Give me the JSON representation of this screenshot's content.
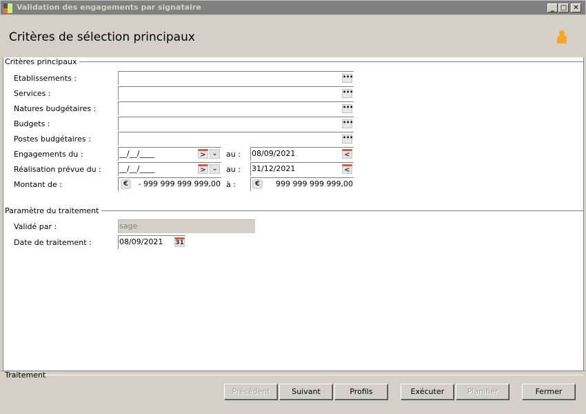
{
  "window": {
    "title": "Validation des engagements par signataire"
  },
  "header": {
    "title": "Critères de sélection principaux",
    "user_icon": "user-icon"
  },
  "main": {
    "section_title": "Critères principaux",
    "fields": [
      {
        "label": "Etablissements :",
        "value": ""
      },
      {
        "label": "Services :",
        "value": ""
      },
      {
        "label": "Natures budgétaires :",
        "value": ""
      },
      {
        "label": "Budgets :",
        "value": ""
      },
      {
        "label": "Postes budgétaires :",
        "value": ""
      }
    ],
    "engagements": {
      "label": "Engagements du :",
      "from": "__/__/____",
      "to_label": "au :",
      "to": "08/09/2021"
    },
    "realisation": {
      "label": "Réalisation prévue du :",
      "from": "__/__/____",
      "to_label": "au :",
      "to": "31/12/2021"
    },
    "montant": {
      "label": "Montant de :",
      "from": "- 999 999 999 999,00",
      "to_label": "à :",
      "to": "999 999 999 999,00"
    }
  },
  "params": {
    "section_title": "Paramètre du traitement",
    "valide_par": {
      "label": "Validé par :",
      "value": "sage"
    },
    "date_traitement": {
      "label": "Date de traitement :",
      "value": "08/09/2021",
      "cal_text": "31"
    }
  },
  "footer": {
    "section_title": "Traitement",
    "buttons": {
      "precedent": "Précédent",
      "suivant": "Suivant",
      "profils": "Profils",
      "executer": "Exécuter",
      "planifier": "Planifier",
      "fermer": "Fermer"
    }
  },
  "colors": {
    "titlebar": "#808080",
    "panel": "#d4d0c8",
    "user_icon": "#f5a623"
  }
}
